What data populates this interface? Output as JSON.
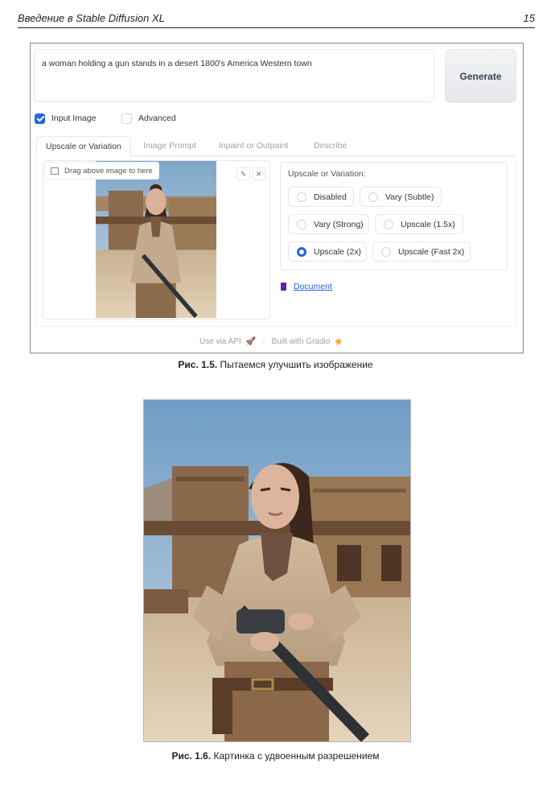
{
  "header": {
    "title": "Введение в Stable Diffusion XL",
    "page_number": "15"
  },
  "ui": {
    "prompt": "a woman holding a gun stands in a desert 1800's America Western town",
    "generate_label": "Generate",
    "input_image_label": "Input Image",
    "input_image_checked": true,
    "advanced_label": "Advanced",
    "advanced_checked": false,
    "tabs": [
      {
        "label": "Upscale or Variation",
        "active": true
      },
      {
        "label": "Image Prompt",
        "active": false
      },
      {
        "label": "Inpaint or Outpaint",
        "active": false
      },
      {
        "label": "Describe",
        "active": false
      }
    ],
    "drag_label": "Drag above image to here",
    "edit_icon": "pencil-icon",
    "clear_icon": "close-icon",
    "options_title": "Upscale or Variation:",
    "options": [
      {
        "label": "Disabled",
        "selected": false
      },
      {
        "label": "Vary (Subtle)",
        "selected": false
      },
      {
        "label": "Vary (Strong)",
        "selected": false
      },
      {
        "label": "Upscale (1.5x)",
        "selected": false
      },
      {
        "label": "Upscale (2x)",
        "selected": true
      },
      {
        "label": "Upscale (Fast 2x)",
        "selected": false
      }
    ],
    "document_label": "Document",
    "footer_api": "Use via API",
    "footer_separator": "·",
    "footer_gradio": "Built with Gradio",
    "accent_color": "#2563eb"
  },
  "captions": {
    "fig1_prefix": "Рис. 1.5.",
    "fig1_text": " Пытаемся улучшить изображение",
    "fig2_prefix": "Рис. 1.6.",
    "fig2_text": " Картинка с удвоенным разрешением"
  }
}
